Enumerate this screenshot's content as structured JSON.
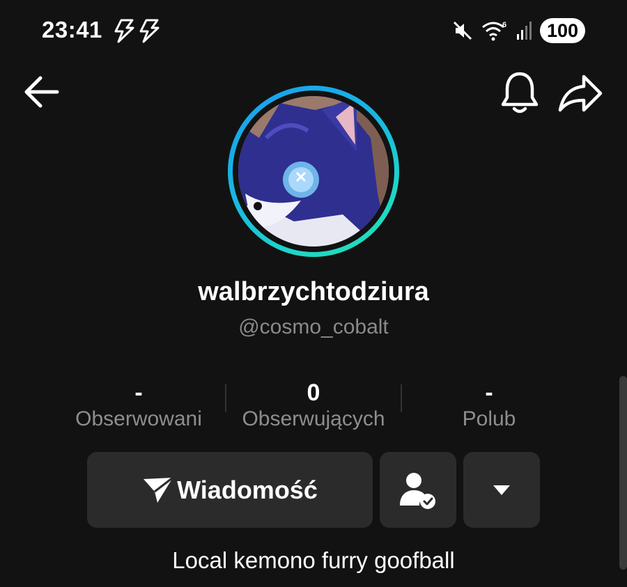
{
  "status_bar": {
    "time": "23:41",
    "battery": "100",
    "icons": [
      "bolt-icon",
      "bolt-icon",
      "mute-icon",
      "wifi-icon",
      "signal-icon"
    ]
  },
  "header": {
    "back_icon": "arrow-left-icon",
    "bell_icon": "bell-icon",
    "share_icon": "share-arrow-icon"
  },
  "profile": {
    "display_name": "walbrzychtodziura",
    "handle": "@cosmo_cobalt",
    "avatar_ring_colors": [
      "#1a9cf0",
      "#24e0b0"
    ]
  },
  "stats": [
    {
      "value": "-",
      "label": "Obserwowani"
    },
    {
      "value": "0",
      "label": "Obserwujących"
    },
    {
      "value": "-",
      "label": "Polub"
    }
  ],
  "actions": {
    "message_label": "Wiadomość",
    "message_icon": "send-icon",
    "friend_icon": "user-check-icon",
    "more_icon": "caret-down-icon"
  },
  "bio": "Local kemono furry goofball",
  "colors": {
    "background": "#121212",
    "button": "#2b2b2b",
    "muted_text": "#8a8a8a"
  }
}
